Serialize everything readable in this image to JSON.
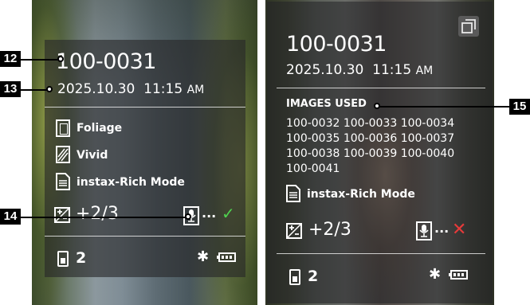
{
  "left_screen": {
    "frame_number": "100-0031",
    "date": "2025.10.30",
    "time": "11:15",
    "ampm": "AM",
    "film_simulation": "Foliage",
    "grain_effect": "Vivid",
    "print_mode": "instax-Rich Mode",
    "exposure_compensation": "+2/3",
    "audio_status": "recorded",
    "print_count": "2",
    "icons": [
      "film-simulation-icon",
      "grain-effect-icon",
      "print-mode-icon",
      "exposure-icon",
      "audio-memo-icon",
      "check-icon",
      "print-count-icon",
      "bluetooth-icon",
      "battery-icon"
    ]
  },
  "right_screen": {
    "frame_number": "100-0031",
    "date": "2025.10.30",
    "time": "11:15",
    "ampm": "AM",
    "images_used_label": "IMAGES USED",
    "images_used": [
      "100-0032 100-0033 100-0034",
      "100-0035 100-0036 100-0037",
      "100-0038 100-0039 100-0040",
      "100-0041"
    ],
    "print_mode": "instax-Rich Mode",
    "exposure_compensation": "+2/3",
    "print_count": "2",
    "icons": [
      "composite-icon",
      "print-mode-icon",
      "exposure-icon",
      "audio-memo-icon",
      "cross-icon",
      "print-count-icon",
      "bluetooth-icon",
      "battery-icon"
    ]
  },
  "callouts": [
    "12",
    "13",
    "14",
    "15"
  ],
  "colors": {
    "ok": "#4fd24f",
    "ng": "#e53a3a",
    "panel": "#262628"
  }
}
